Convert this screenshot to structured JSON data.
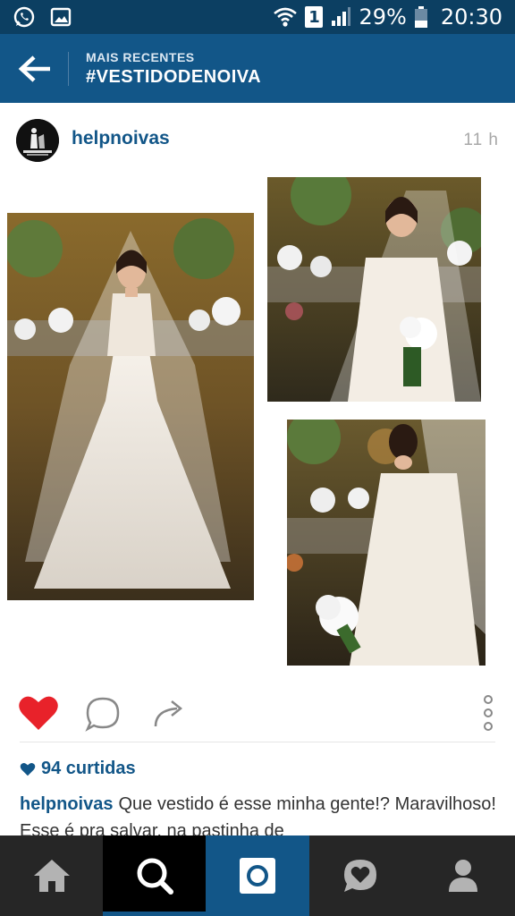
{
  "status_bar": {
    "battery": "29%",
    "time": "20:30",
    "sim_label": "1"
  },
  "header": {
    "subtitle": "MAIS RECENTES",
    "title": "#VESTIDODENOIVA"
  },
  "post": {
    "username": "helpnoivas",
    "time_ago": "11 h",
    "likes": "94 curtidas",
    "caption_user": "helpnoivas",
    "caption_text": "Que vestido é esse minha gente!? Maravilhoso! Esse é pra salvar, na pastinha de"
  },
  "colors": {
    "brand": "#125688",
    "status_bar": "#0c3f62",
    "like_red": "#e8222a",
    "nav_bg": "#262626"
  },
  "icons": [
    "whatsapp-icon",
    "gallery-icon",
    "wifi-icon",
    "signal-icon",
    "battery-icon",
    "back-arrow-icon",
    "heart-icon",
    "comment-icon",
    "share-icon",
    "more-options-icon",
    "home-icon",
    "search-icon",
    "camera-icon",
    "activity-icon",
    "profile-icon"
  ]
}
